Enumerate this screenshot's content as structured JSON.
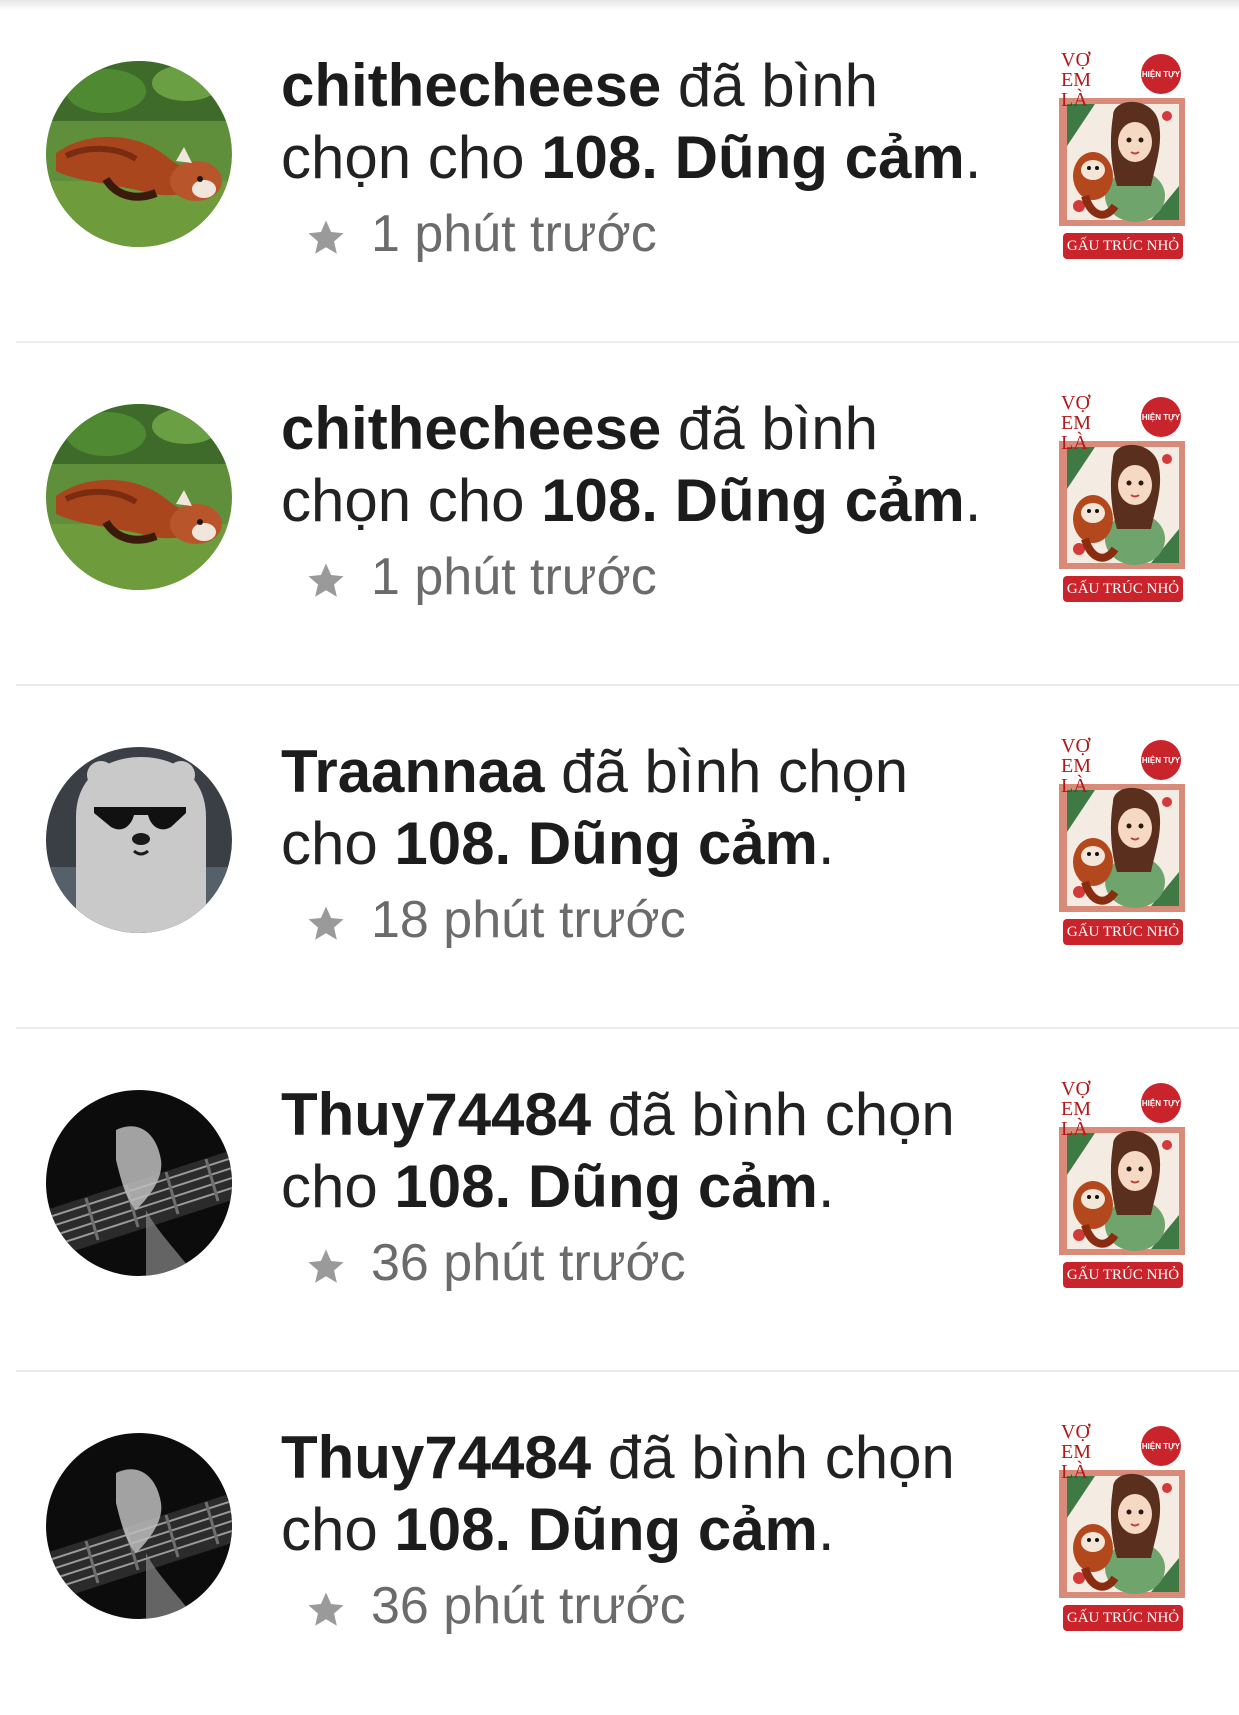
{
  "colors": {
    "text_primary": "#222222",
    "text_secondary": "#6b6b6b",
    "star": "#9a9a9a",
    "divider": "#ececec",
    "cover_accent": "#c9242b"
  },
  "feed": {
    "items": [
      {
        "username": "chithecheese",
        "action": " đã bình chọn cho ",
        "chapter": "108. Dũng cảm",
        "period": ".",
        "time": "1 phút trước",
        "avatar_icon": "red-panda-avatar",
        "cover": {
          "title_line1": "VỢ",
          "title_line2": "EM LÀ",
          "badge": "HIỆN TỰY",
          "author": "GẤU TRÚC NHỎ"
        }
      },
      {
        "username": "chithecheese",
        "action": " đã bình chọn cho ",
        "chapter": "108. Dũng cảm",
        "period": ".",
        "time": "1 phút trước",
        "avatar_icon": "red-panda-avatar",
        "cover": {
          "title_line1": "VỢ",
          "title_line2": "EM LÀ",
          "badge": "HIỆN TỰY",
          "author": "GẤU TRÚC NHỎ"
        }
      },
      {
        "username": "Traannaa",
        "action": " đã bình chọn cho ",
        "chapter": "108. Dũng cảm",
        "period": ".",
        "time": "18 phút trước",
        "avatar_icon": "cool-bear-avatar",
        "cover": {
          "title_line1": "VỢ",
          "title_line2": "EM LÀ",
          "badge": "HIỆN TỰY",
          "author": "GẤU TRÚC NHỎ"
        }
      },
      {
        "username": "Thuy74484",
        "action": " đã bình chọn cho ",
        "chapter": "108. Dũng cảm",
        "period": ".",
        "time": "36 phút trước",
        "avatar_icon": "guitar-avatar",
        "cover": {
          "title_line1": "VỢ",
          "title_line2": "EM LÀ",
          "badge": "HIỆN TỰY",
          "author": "GẤU TRÚC NHỎ"
        }
      },
      {
        "username": "Thuy74484",
        "action": " đã bình chọn cho ",
        "chapter": "108. Dũng cảm",
        "period": ".",
        "time": "36 phút trước",
        "avatar_icon": "guitar-avatar",
        "cover": {
          "title_line1": "VỢ",
          "title_line2": "EM LÀ",
          "badge": "HIỆN TỰY",
          "author": "GẤU TRÚC NHỎ"
        }
      }
    ]
  }
}
